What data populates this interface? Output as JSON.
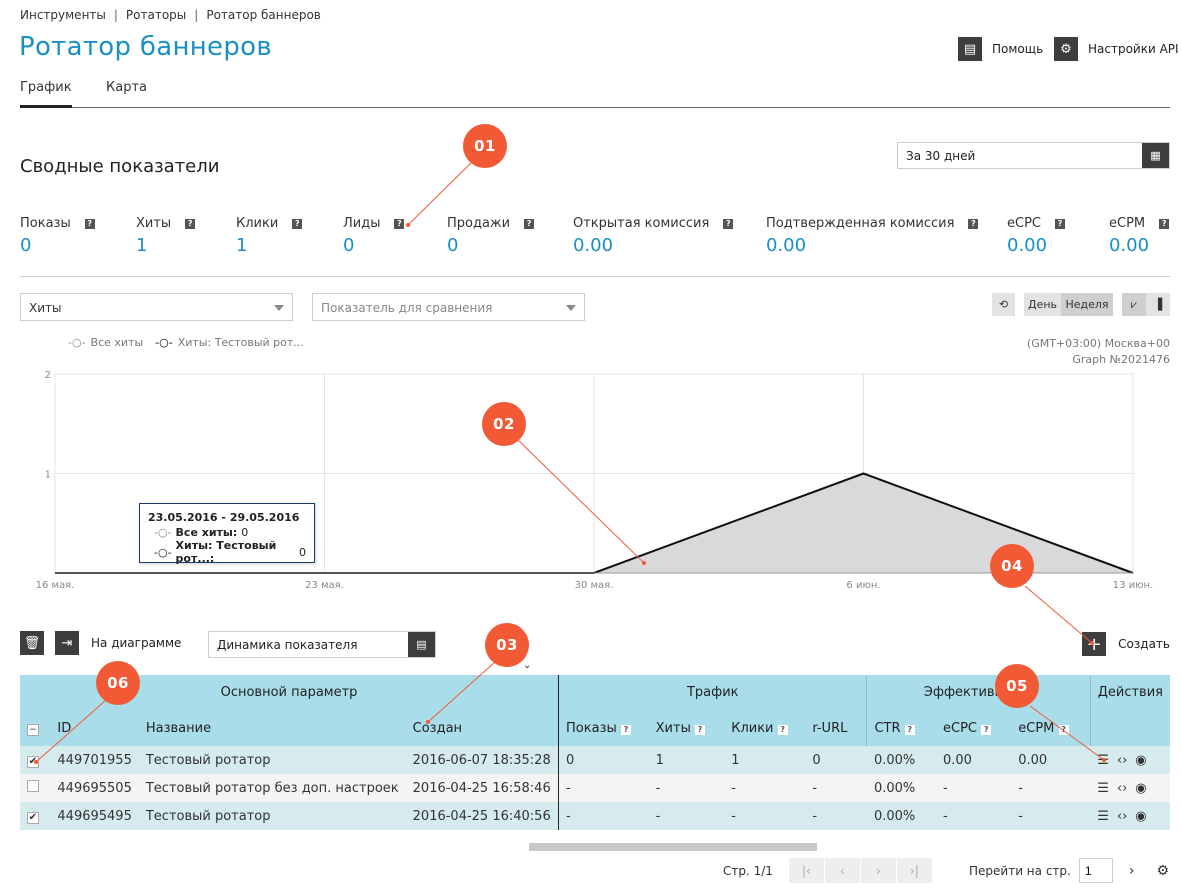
{
  "breadcrumb": [
    "Инструменты",
    "Ротаторы",
    "Ротатор баннеров"
  ],
  "breadcrumb_sep": "|",
  "title": "Ротатор баннеров",
  "top_actions": {
    "help": "Помощь",
    "api": "Настройки API"
  },
  "tabs": [
    {
      "label": "График",
      "active": true
    },
    {
      "label": "Карта",
      "active": false
    }
  ],
  "summary": {
    "title": "Сводные показатели",
    "period": "За 30 дней",
    "metrics": [
      {
        "label": "Показы",
        "value": "0"
      },
      {
        "label": "Хиты",
        "value": "1"
      },
      {
        "label": "Клики",
        "value": "1"
      },
      {
        "label": "Лиды",
        "value": "0"
      },
      {
        "label": "Продажи",
        "value": "0"
      },
      {
        "label": "Открытая комиссия",
        "value": "0.00"
      },
      {
        "label": "Подтвержденная комиссия",
        "value": "0.00"
      },
      {
        "label": "eCPC",
        "value": "0.00"
      },
      {
        "label": "eCPM",
        "value": "0.00"
      }
    ]
  },
  "chart_controls": {
    "metric_select": "Хиты",
    "compare_placeholder": "Показатель для сравнения",
    "day": "День",
    "week": "Неделя"
  },
  "chart_data": {
    "type": "area",
    "series": [
      {
        "name": "Все хиты",
        "values": [
          0,
          0,
          0,
          0,
          0
        ]
      },
      {
        "name": "Хиты: Тестовый рот...",
        "values": [
          0,
          0,
          0,
          1,
          0
        ]
      }
    ],
    "x": [
      "16 мая.",
      "23 мая.",
      "30 мая.",
      "6 июн.",
      "13 июн."
    ],
    "ylim": [
      0,
      2
    ],
    "yticks": [
      "2",
      "1"
    ],
    "timezone": "(GMT+03:00) Москва+00",
    "graph_id": "Graph №2021476",
    "tooltip": {
      "title": "23.05.2016 - 29.05.2016",
      "rows": [
        {
          "label": "Все хиты:",
          "value": "0"
        },
        {
          "label": "Хиты: Тестовый рот...:",
          "value": "0"
        }
      ]
    }
  },
  "markers": [
    "01",
    "02",
    "03",
    "04",
    "05",
    "06"
  ],
  "table_toolbar": {
    "on_chart": "На диаграмме",
    "dynamics": "Динамика показателя",
    "create": "Создать"
  },
  "table": {
    "groups": [
      "Основной параметр",
      "Трафик",
      "Эффективность",
      "Действия"
    ],
    "columns": [
      "ID",
      "Название",
      "Создан",
      "Показы",
      "Хиты",
      "Клики",
      "r-URL",
      "CTR",
      "eCPC",
      "eCPM"
    ],
    "rows": [
      {
        "checked": true,
        "id": "449701955",
        "name": "Тестовый ротатор",
        "created": "2016-06-07 18:35:28",
        "shows": "0",
        "hits": "1",
        "clicks": "1",
        "rurl": "0",
        "ctr": "0.00%",
        "ecpc": "0.00",
        "ecpm": "0.00"
      },
      {
        "checked": false,
        "id": "449695505",
        "name": "Тестовый ротатор без доп. настроек",
        "created": "2016-04-25 16:58:46",
        "shows": "-",
        "hits": "-",
        "clicks": "-",
        "rurl": "-",
        "ctr": "0.00%",
        "ecpc": "-",
        "ecpm": "-"
      },
      {
        "checked": true,
        "id": "449695495",
        "name": "Тестовый ротатор",
        "created": "2016-04-25 16:40:56",
        "shows": "-",
        "hits": "-",
        "clicks": "-",
        "rurl": "-",
        "ctr": "0.00%",
        "ecpc": "-",
        "ecpm": "-"
      }
    ]
  },
  "pager": {
    "page": "Стр. 1/1",
    "goto_label": "Перейти на стр.",
    "goto_value": "1"
  }
}
